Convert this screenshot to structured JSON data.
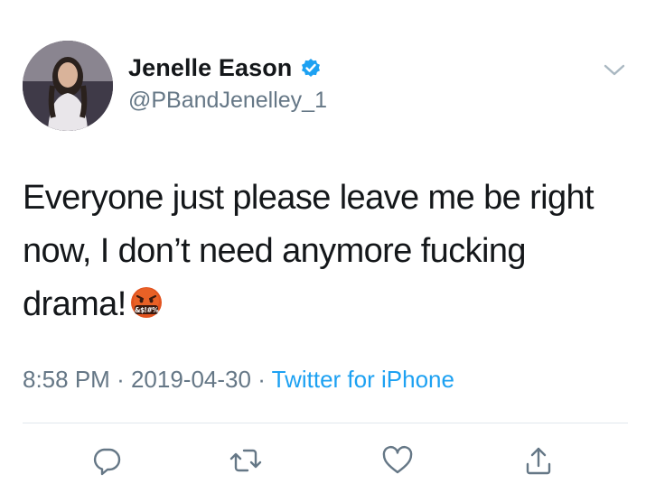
{
  "author": {
    "display_name": "Jenelle Eason",
    "handle": "@PBandJenelley_1",
    "verified_icon": "verified-badge-icon",
    "avatar": "profile-photo"
  },
  "tweet": {
    "text_prefix": "Everyone just please leave me be right now, I don’t need anymore fucking drama!",
    "emoji": "face-with-symbols-on-mouth",
    "emoji_symbols": "&$!#%"
  },
  "meta": {
    "time": "8:58 PM",
    "separator": "·",
    "date": "2019-04-30",
    "source": "Twitter for iPhone"
  },
  "actions": {
    "reply": "reply-icon",
    "retweet": "retweet-icon",
    "like": "heart-icon",
    "share": "share-icon"
  },
  "colors": {
    "text": "#14171a",
    "secondary": "#657786",
    "link": "#1da1f2",
    "verified": "#1da1f2",
    "divider": "#e1e8ed"
  }
}
